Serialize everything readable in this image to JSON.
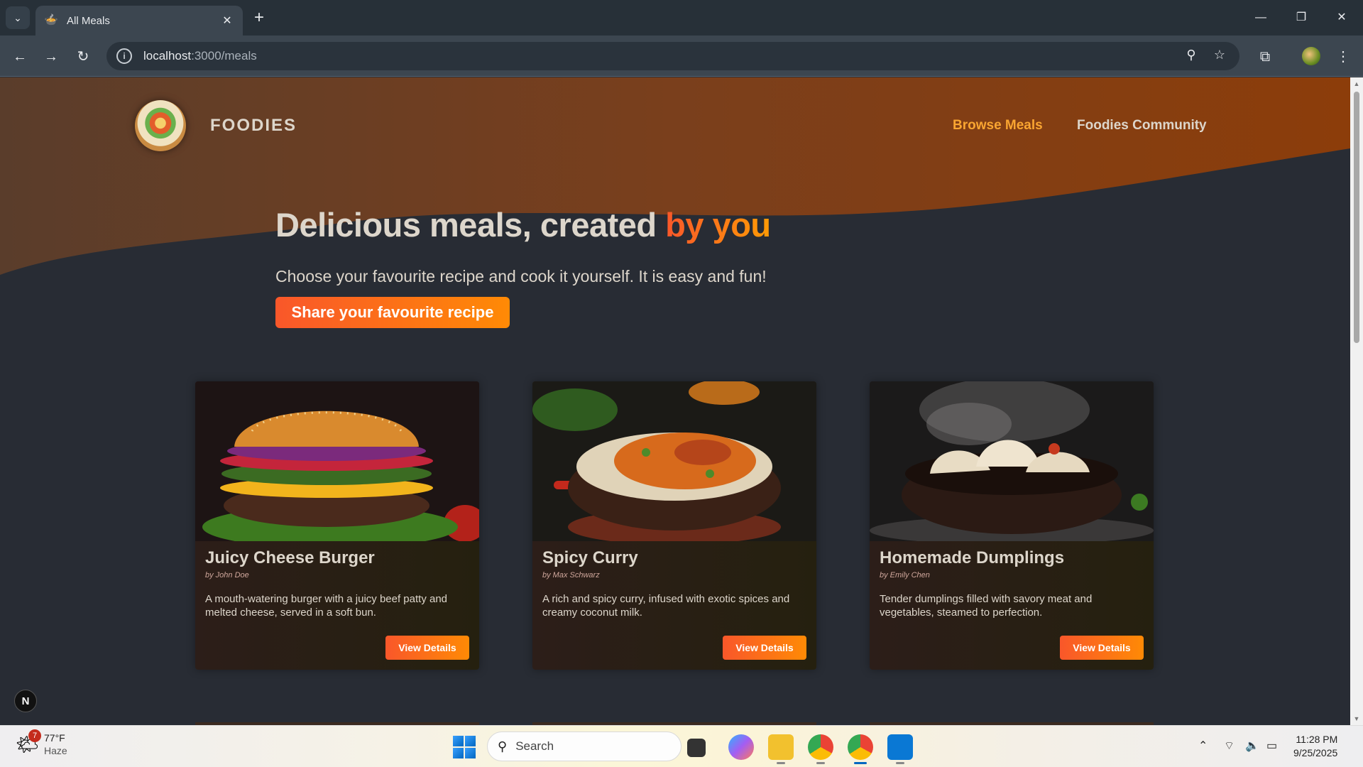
{
  "browser": {
    "tab_title": "All Meals",
    "tab_favicon": "🍲",
    "url_host": "localhost",
    "url_path": ":3000/meals"
  },
  "site": {
    "logo_text": "FOODIES",
    "nav": [
      {
        "label": "Browse Meals",
        "active": true
      },
      {
        "label": "Foodies Community",
        "active": false
      }
    ]
  },
  "hero": {
    "title_main": "Delicious meals, created ",
    "title_accent": "by you",
    "subtitle": "Choose your favourite recipe and cook it yourself. It is easy and fun!",
    "cta_label": "Share your favourite recipe"
  },
  "meals": [
    {
      "title": "Juicy Cheese Burger",
      "author": "by John Doe",
      "summary": "A mouth-watering burger with a juicy beef patty and melted cheese, served in a soft bun.",
      "button": "View Details"
    },
    {
      "title": "Spicy Curry",
      "author": "by Max Schwarz",
      "summary": "A rich and spicy curry, infused with exotic spices and creamy coconut milk.",
      "button": "View Details"
    },
    {
      "title": "Homemade Dumplings",
      "author": "by Emily Chen",
      "summary": "Tender dumplings filled with savory meat and vegetables, steamed to perfection.",
      "button": "View Details"
    }
  ],
  "dev_badge": "N",
  "taskbar": {
    "weather_temp": "77°F",
    "weather_desc": "Haze",
    "weather_badge": "7",
    "search_label": "Search",
    "time": "11:28 PM",
    "date": "9/25/2025"
  },
  "colors": {
    "accent_start": "#f9572a",
    "accent_end": "#ff9b05",
    "active_nav": "#f9a531",
    "text": "#ddd6cb",
    "page_bg": "#282c34"
  }
}
